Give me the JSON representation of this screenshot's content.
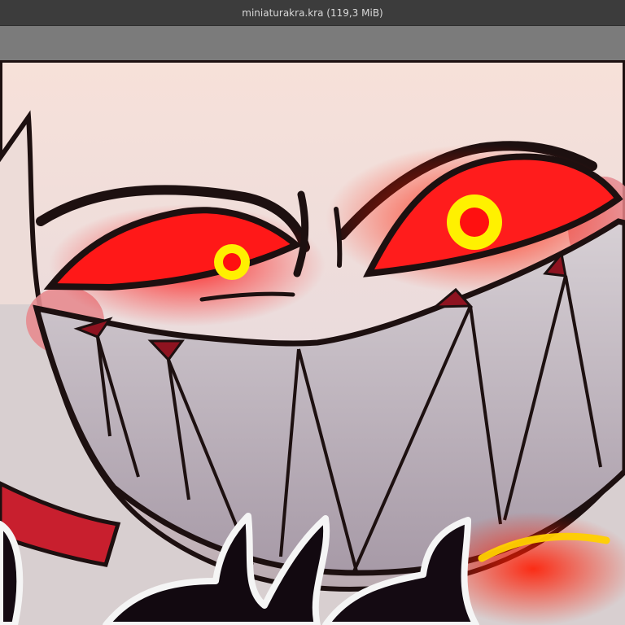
{
  "window": {
    "title": "miniaturakra.kra (119,3 MiB)"
  },
  "canvas": {
    "artwork": "smiling-demon-face-illustration"
  },
  "colors": {
    "titlebar": "#3c3c3c",
    "toolbar": "#7b7b7b",
    "skin": "#f0d7cf",
    "eye_red": "#ff1e1e",
    "pupil_yellow": "#f2ea00",
    "teeth": "#c8c1c7",
    "outline": "#1d1010"
  }
}
